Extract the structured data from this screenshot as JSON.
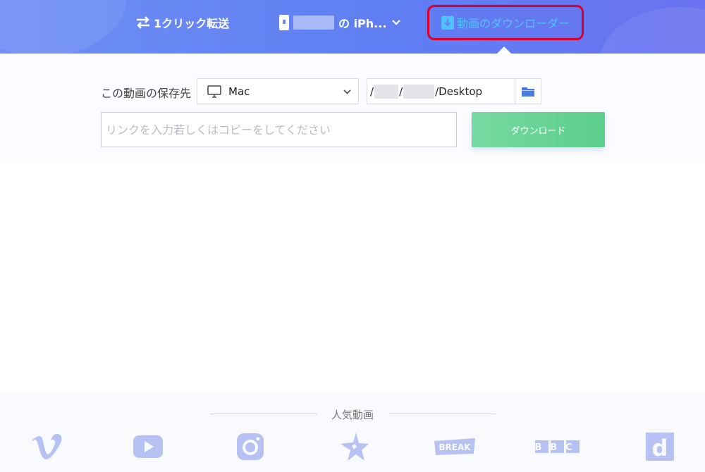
{
  "header": {
    "transfer_label": "1クリック転送",
    "device_suffix": "の iPh...",
    "downloader_label": "動画のダウンローダー"
  },
  "form": {
    "save_label": "この動画の保存先",
    "device_select": "Mac",
    "path_sep": "/",
    "path_tail": "/Desktop",
    "link_placeholder": "リンクを入力若しくはコピーをしてください",
    "download_label": "ダウンロード"
  },
  "popular": {
    "title": "人気動画",
    "sites": [
      "vimeo",
      "youtube",
      "instagram",
      "dailymotion-star",
      "break",
      "bbc",
      "dailymotion"
    ],
    "break_text": "BREAK",
    "bbc_text": "BBC",
    "d_text": "d"
  },
  "colors": {
    "header": "#6383f3",
    "highlight": "#d9002b",
    "downloader_text": "#4fc3ff",
    "download_button": "#66d193",
    "site_icon": "#b6c1f4"
  }
}
